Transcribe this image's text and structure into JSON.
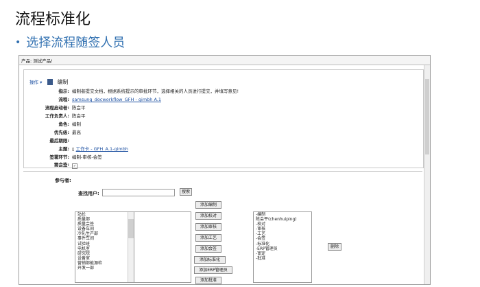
{
  "slide": {
    "title": "流程标准化",
    "bullet": "选择流程随签人员"
  },
  "product_bar": "产品: 测试产品!",
  "topbox": {
    "operation": "操作",
    "edit": "编制",
    "fields": [
      {
        "label": "指示:",
        "value": "编制者提交文档，根据系统提示的审批环节，选择相关的人员进行提交，并填写意见!"
      },
      {
        "label": "流程:",
        "value": "samsung_docworkflow_GFH - gimbh A.1",
        "link": true
      },
      {
        "label": "流程启动者:",
        "value": "陈会平"
      },
      {
        "label": "工作负责人:",
        "value": "陈会平"
      },
      {
        "label": "角色:",
        "value": "编制"
      },
      {
        "label": "优先级:",
        "value": "最高"
      },
      {
        "label": "最后期限:",
        "value": ""
      },
      {
        "label": "主题:",
        "value": "工作卡 - GFH_A.1-gimbh",
        "link": true
      },
      {
        "label": "签署环节:",
        "value": "编制-审核-会签"
      },
      {
        "label": "需会签:",
        "value": "✓",
        "checkbox": true
      }
    ]
  },
  "participants": {
    "label": "参与者:",
    "find_label": "查找用户:",
    "find_button": "搜索",
    "left_list": [
      "站长",
      "质量部",
      "质量会签",
      "设备车间",
      "冷轧生产部",
      "事件车间",
      "试验班",
      "电机室",
      "研究院",
      "设备室",
      "营销部能源检",
      "开发一部"
    ],
    "buttons": [
      "添加编制",
      "添加校对",
      "添加审核",
      "添加工艺",
      "添加会签",
      "添加标准化",
      "添加ERP管理员",
      "添加批准"
    ],
    "right_list": [
      "-编制",
      "陈会平(chenhuiping)",
      "-校对",
      "-审核",
      "-工艺",
      "-会签",
      "-标准化",
      "-ERP管理员",
      "-审定",
      "-批准"
    ],
    "delete_button": "删除"
  }
}
